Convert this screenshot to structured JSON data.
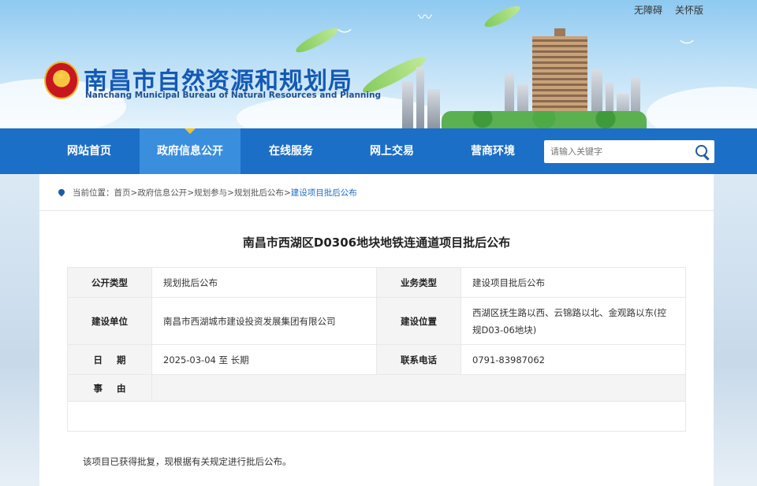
{
  "top_links": [
    "无障碍",
    "关怀版"
  ],
  "site": {
    "title": "南昌市自然资源和规划局",
    "subtitle": "Nanchang Municipal Bureau of Natural Resources and Planning"
  },
  "nav": {
    "items": [
      "网站首页",
      "政府信息公开",
      "在线服务",
      "网上交易",
      "营商环境"
    ],
    "active_index": 1,
    "search_placeholder": "请输入关键字"
  },
  "breadcrumb": {
    "label": "当前位置：",
    "items": [
      "首页",
      "政府信息公开",
      "规划参与",
      "规划批后公布"
    ],
    "current": "建设项目批后公布",
    "separator": ">"
  },
  "article": {
    "title": "南昌市西湖区D0306地块地铁连通道项目批后公布",
    "rows": {
      "type_label": "公开类型",
      "type_value": "规划批后公布",
      "biz_label": "业务类型",
      "biz_value": "建设项目批后公布",
      "unit_label": "建设单位",
      "unit_value": "南昌市西湖城市建设投资发展集团有限公司",
      "loc_label": "建设位置",
      "loc_value": "西湖区抚生路以西、云锦路以北、金观路以东(控规D03-06地块)",
      "date_label": "日期",
      "date_value": "2025-03-04 至 长期",
      "phone_label": "联系电话",
      "phone_value": "0791-83987062",
      "reason_label": "事由",
      "reason_value": ""
    },
    "note": "该项目已获得批复，现根据有关规定进行批后公布。"
  },
  "colors": {
    "nav_bg": "#1c6fc6",
    "nav_active": "#3a8ede",
    "title_blue": "#1459b4",
    "link_current": "#1c6fc6"
  }
}
